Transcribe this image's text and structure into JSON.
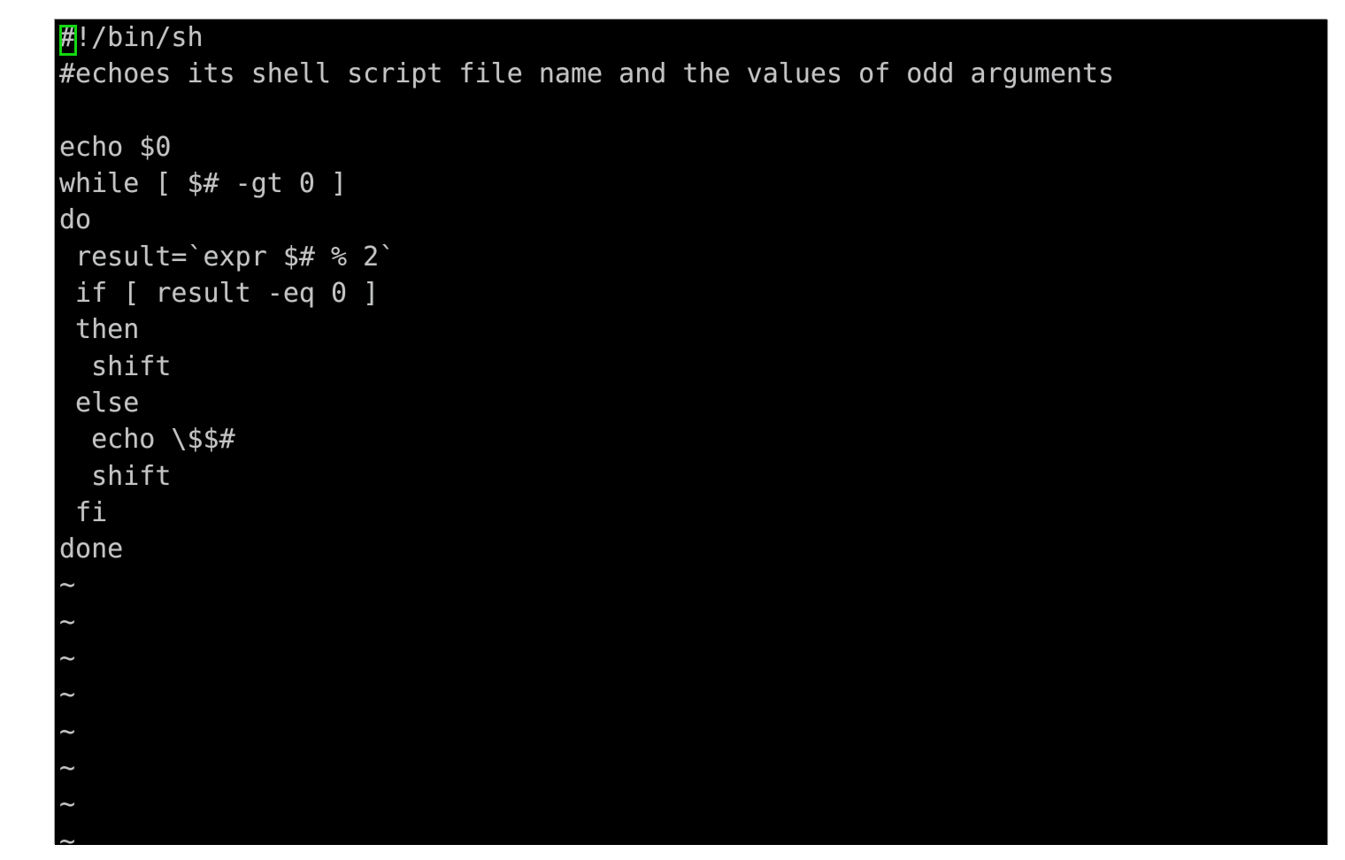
{
  "terminal": {
    "kind": "vim-editor",
    "background_color": "#000000",
    "foreground_color": "#c3c3c3",
    "cursor": {
      "style": "block-outline",
      "color": "#12d812",
      "line": 1,
      "column": 1,
      "char": "#"
    },
    "page_background_color": "#ffffff",
    "lines": [
      "#!/bin/sh",
      "#echoes its shell script file name and the values of odd arguments",
      "",
      "echo $0",
      "while [ $# -gt 0 ]",
      "do",
      " result=`expr $# % 2`",
      " if [ result -eq 0 ]",
      " then",
      "  shift",
      " else",
      "  echo \\$$#",
      "  shift",
      " fi",
      "done"
    ],
    "empty_line_markers": [
      "~",
      "~",
      "~",
      "~",
      "~",
      "~",
      "~",
      "~"
    ]
  }
}
